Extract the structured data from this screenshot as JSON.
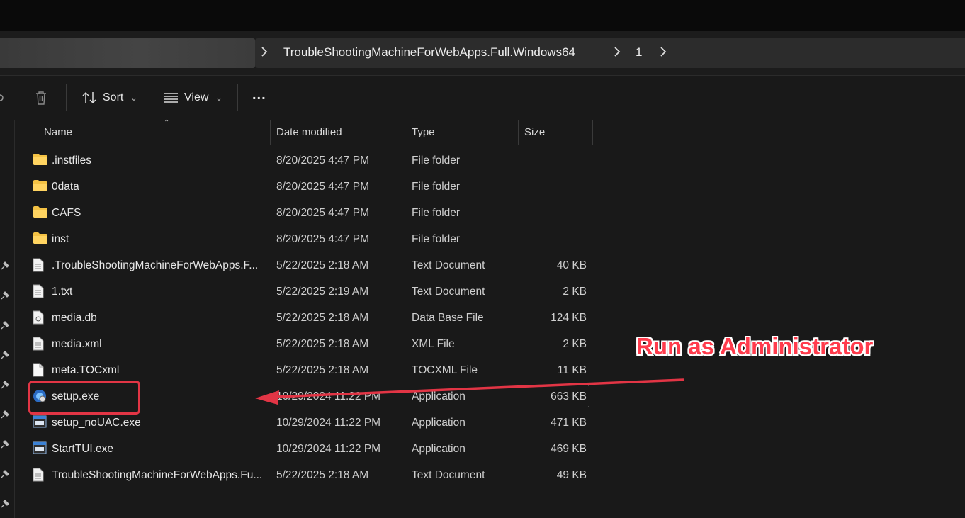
{
  "breadcrumb": [
    {
      "label": "TroubleShootingMachineForWebApps.Full.Windows64"
    },
    {
      "label": "1"
    }
  ],
  "toolbar": {
    "sort_label": "Sort",
    "view_label": "View",
    "more_label": "..."
  },
  "columns": {
    "name": "Name",
    "date": "Date modified",
    "type": "Type",
    "size": "Size"
  },
  "files": [
    {
      "name": ".instfiles",
      "date": "8/20/2025 4:47 PM",
      "type": "File folder",
      "size": "",
      "icon": "folder-icon"
    },
    {
      "name": "0data",
      "date": "8/20/2025 4:47 PM",
      "type": "File folder",
      "size": "",
      "icon": "folder-icon"
    },
    {
      "name": "CAFS",
      "date": "8/20/2025 4:47 PM",
      "type": "File folder",
      "size": "",
      "icon": "folder-icon"
    },
    {
      "name": "inst",
      "date": "8/20/2025 4:47 PM",
      "type": "File folder",
      "size": "",
      "icon": "folder-icon"
    },
    {
      "name": ".TroubleShootingMachineForWebApps.F...",
      "date": "5/22/2025 2:18 AM",
      "type": "Text Document",
      "size": "40 KB",
      "icon": "text-document-icon"
    },
    {
      "name": "1.txt",
      "date": "5/22/2025 2:19 AM",
      "type": "Text Document",
      "size": "2 KB",
      "icon": "text-document-icon"
    },
    {
      "name": "media.db",
      "date": "5/22/2025 2:18 AM",
      "type": "Data Base File",
      "size": "124 KB",
      "icon": "database-file-icon"
    },
    {
      "name": "media.xml",
      "date": "5/22/2025 2:18 AM",
      "type": "XML File",
      "size": "2 KB",
      "icon": "text-document-icon"
    },
    {
      "name": "meta.TOCxml",
      "date": "5/22/2025 2:18 AM",
      "type": "TOCXML File",
      "size": "11 KB",
      "icon": "blank-file-icon"
    },
    {
      "name": "setup.exe",
      "date": "10/29/2024 11:22 PM",
      "type": "Application",
      "size": "663 KB",
      "icon": "setup-app-icon",
      "selected": true
    },
    {
      "name": "setup_noUAC.exe",
      "date": "10/29/2024 11:22 PM",
      "type": "Application",
      "size": "471 KB",
      "icon": "application-icon"
    },
    {
      "name": "StartTUI.exe",
      "date": "10/29/2024 11:22 PM",
      "type": "Application",
      "size": "469 KB",
      "icon": "application-icon"
    },
    {
      "name": "TroubleShootingMachineForWebApps.Fu...",
      "date": "5/22/2025 2:18 AM",
      "type": "Text Document",
      "size": "49 KB",
      "icon": "text-document-icon"
    }
  ],
  "annotation": {
    "text": "Run as Administrator"
  },
  "colors": {
    "annotation": "#e23545",
    "background": "#191919",
    "folder": "#f4c244"
  }
}
